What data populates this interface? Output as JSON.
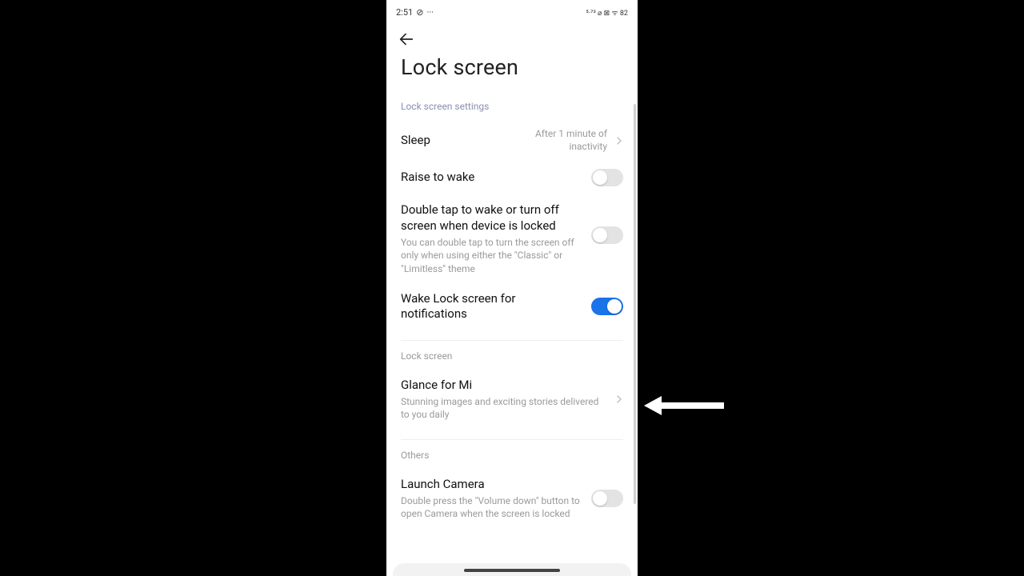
{
  "statusbar": {
    "time": "2:51",
    "right": "⁵·⁷³  ⌀  ⊠  ᯤ  82"
  },
  "page": {
    "title": "Lock screen"
  },
  "section1": {
    "header": "Lock screen settings",
    "sleep": {
      "label": "Sleep",
      "value": "After 1 minute of inactivity"
    },
    "raise": {
      "label": "Raise to wake"
    },
    "doubletap": {
      "label": "Double tap to wake or turn off screen when device is locked",
      "sub": "You can double tap to turn the screen off only when using either the \"Classic\" or \"Limitless\" theme"
    },
    "wakenotif": {
      "label": "Wake Lock screen for notifications"
    }
  },
  "section2": {
    "header": "Lock screen",
    "glance": {
      "label": "Glance for Mi",
      "sub": "Stunning images and exciting stories delivered to you daily"
    }
  },
  "section3": {
    "header": "Others",
    "camera": {
      "label": "Launch Camera",
      "sub": "Double press the \"Volume down\" button to open Camera when the screen is locked"
    }
  }
}
